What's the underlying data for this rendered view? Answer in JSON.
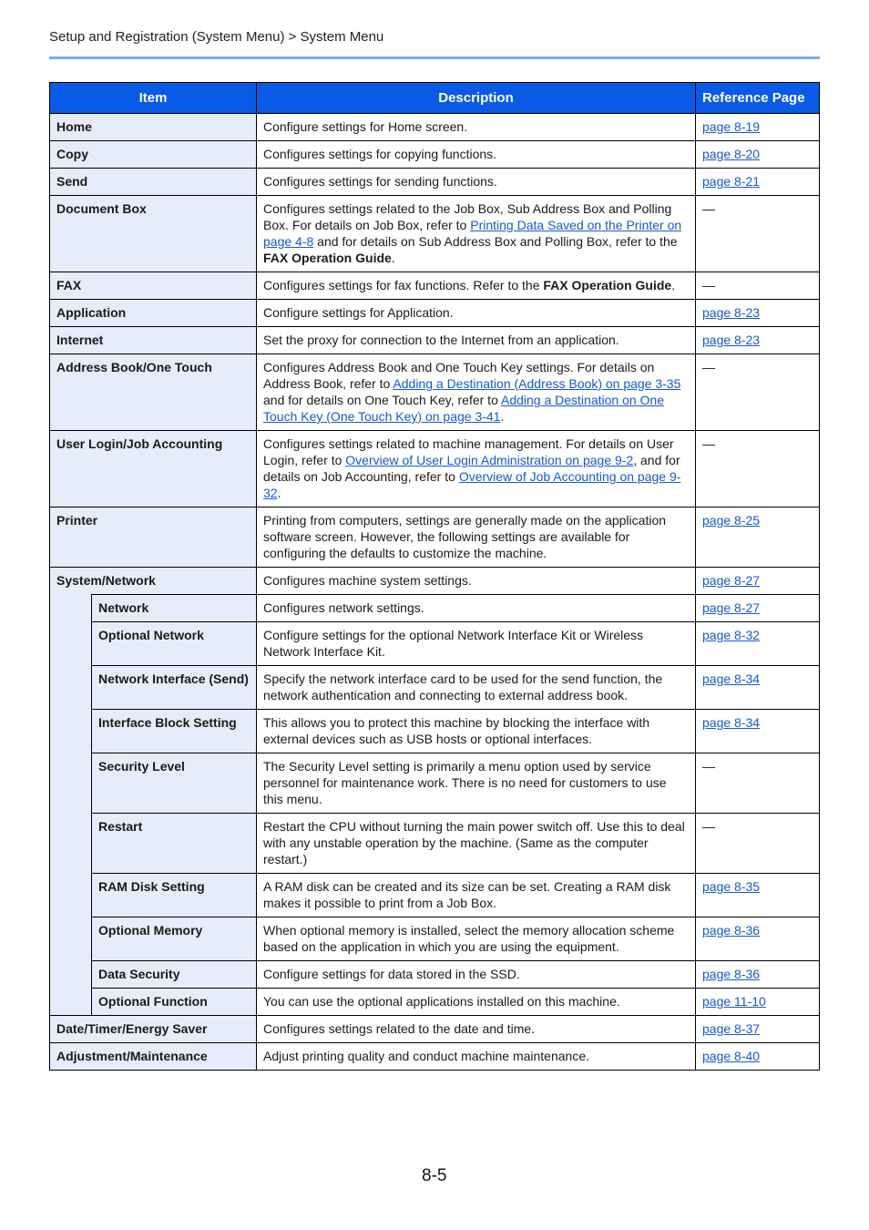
{
  "header": {
    "breadcrumb": "Setup and Registration (System Menu) > System Menu"
  },
  "table": {
    "columns": {
      "item": "Item",
      "description": "Description",
      "reference": "Reference Page"
    },
    "rows": [
      {
        "item": "Home",
        "desc": [
          {
            "t": "Configure settings for Home screen."
          }
        ],
        "ref": "page 8-19"
      },
      {
        "item": "Copy",
        "desc": [
          {
            "t": "Configures settings for copying functions."
          }
        ],
        "ref": "page 8-20"
      },
      {
        "item": "Send",
        "desc": [
          {
            "t": "Configures settings for sending functions."
          }
        ],
        "ref": "page 8-21"
      },
      {
        "item": "Document Box",
        "desc": [
          {
            "t": "Configures settings related to the Job Box, Sub Address Box and Polling Box. For details on Job Box, refer to "
          },
          {
            "t": "Printing Data Saved on the Printer on page 4-8",
            "link": true
          },
          {
            "t": " and for details on Sub Address Box and Polling Box, refer to the "
          },
          {
            "t": "FAX Operation Guide",
            "bold": true
          },
          {
            "t": "."
          }
        ],
        "ref": "—"
      },
      {
        "item": "FAX",
        "desc": [
          {
            "t": "Configures settings for fax functions. Refer to the "
          },
          {
            "t": "FAX Operation Guide",
            "bold": true
          },
          {
            "t": "."
          }
        ],
        "ref": "—"
      },
      {
        "item": "Application",
        "desc": [
          {
            "t": "Configure settings for Application."
          }
        ],
        "ref": "page 8-23"
      },
      {
        "item": "Internet",
        "desc": [
          {
            "t": "Set the proxy for connection to the Internet from an application."
          }
        ],
        "ref": "page 8-23"
      },
      {
        "item": "Address Book/One Touch",
        "desc": [
          {
            "t": "Configures Address Book and One Touch Key settings. For details on Address Book, refer to "
          },
          {
            "t": "Adding a Destination (Address Book) on page 3-35",
            "link": true
          },
          {
            "t": " and for details on One Touch Key, refer to "
          },
          {
            "t": "Adding a Destination on One Touch Key (One Touch Key) on page 3-41",
            "link": true
          },
          {
            "t": "."
          }
        ],
        "ref": "—"
      },
      {
        "item": "User Login/Job Accounting",
        "desc": [
          {
            "t": "Configures settings related to machine management. For details on User Login, refer to "
          },
          {
            "t": "Overview of User Login Administration on page 9-2",
            "link": true
          },
          {
            "t": ", and for details on Job Accounting, refer to "
          },
          {
            "t": "Overview of Job Accounting on page 9-32",
            "link": true
          },
          {
            "t": "."
          }
        ],
        "ref": "—"
      },
      {
        "item": "Printer",
        "desc": [
          {
            "t": "Printing from computers, settings are generally made on the application software screen. However, the following settings are available for configuring the defaults to customize the machine."
          }
        ],
        "ref": "page 8-25"
      },
      {
        "item": "System/Network",
        "desc": [
          {
            "t": "Configures machine system settings."
          }
        ],
        "ref": "page 8-27",
        "children": [
          {
            "item": "Network",
            "desc": [
              {
                "t": "Configures network settings."
              }
            ],
            "ref": "page 8-27"
          },
          {
            "item": "Optional Network",
            "desc": [
              {
                "t": "Configure settings for the optional Network Interface Kit or Wireless Network Interface Kit."
              }
            ],
            "ref": "page 8-32"
          },
          {
            "item": "Network Interface (Send)",
            "desc": [
              {
                "t": "Specify the network interface card to be used for the send function, the network authentication and connecting to external address book."
              }
            ],
            "ref": "page 8-34"
          },
          {
            "item": "Interface Block Setting",
            "desc": [
              {
                "t": "This allows you to protect this machine by blocking the interface with external devices such as USB hosts or optional interfaces."
              }
            ],
            "ref": "page 8-34"
          },
          {
            "item": "Security Level",
            "desc": [
              {
                "t": "The Security Level setting is primarily a menu option used by service personnel for maintenance work. There is no need for customers to use this menu."
              }
            ],
            "ref": "—"
          },
          {
            "item": "Restart",
            "desc": [
              {
                "t": "Restart the CPU without turning the main power switch off. Use this to deal with any unstable operation by the machine. (Same as the computer restart.)"
              }
            ],
            "ref": "—"
          },
          {
            "item": "RAM Disk Setting",
            "desc": [
              {
                "t": "A RAM disk can be created and its size can be set. Creating a RAM disk makes it possible to print from a Job Box."
              }
            ],
            "ref": "page 8-35"
          },
          {
            "item": "Optional Memory",
            "desc": [
              {
                "t": "When optional memory is installed, select the memory allocation scheme based on the application in which you are using the equipment."
              }
            ],
            "ref": "page 8-36"
          },
          {
            "item": "Data Security",
            "desc": [
              {
                "t": "Configure settings for data stored in the SSD."
              }
            ],
            "ref": "page 8-36"
          },
          {
            "item": "Optional Function",
            "desc": [
              {
                "t": "You can use the optional applications installed on this machine."
              }
            ],
            "ref": "page 11-10"
          }
        ]
      },
      {
        "item": "Date/Timer/Energy Saver",
        "desc": [
          {
            "t": "Configures settings related to the date and time."
          }
        ],
        "ref": "page 8-37"
      },
      {
        "item": "Adjustment/Maintenance",
        "desc": [
          {
            "t": "Adjust printing quality and conduct machine maintenance."
          }
        ],
        "ref": "page 8-40"
      }
    ]
  },
  "footer": {
    "page_number": "8-5"
  }
}
